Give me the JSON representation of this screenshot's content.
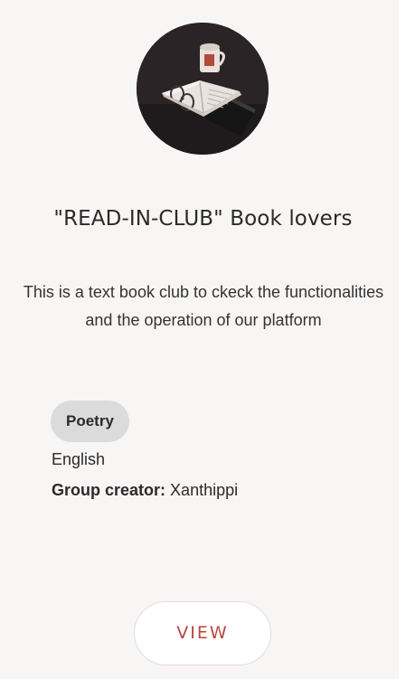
{
  "card": {
    "image_icon": "book-club-photo",
    "title": "\"READ-IN-CLUB\" Book lovers",
    "description": "This is a text book club to ckeck the functionalities and the operation of our platform",
    "tag": "Poetry",
    "language": "English",
    "creator_label": "Group creator:",
    "creator_name": "Xanthippi",
    "view_label": "VIEW"
  },
  "colors": {
    "card_background": "#f8f6f5",
    "tag_background": "#dcdbdb",
    "button_text": "#b8453f"
  }
}
